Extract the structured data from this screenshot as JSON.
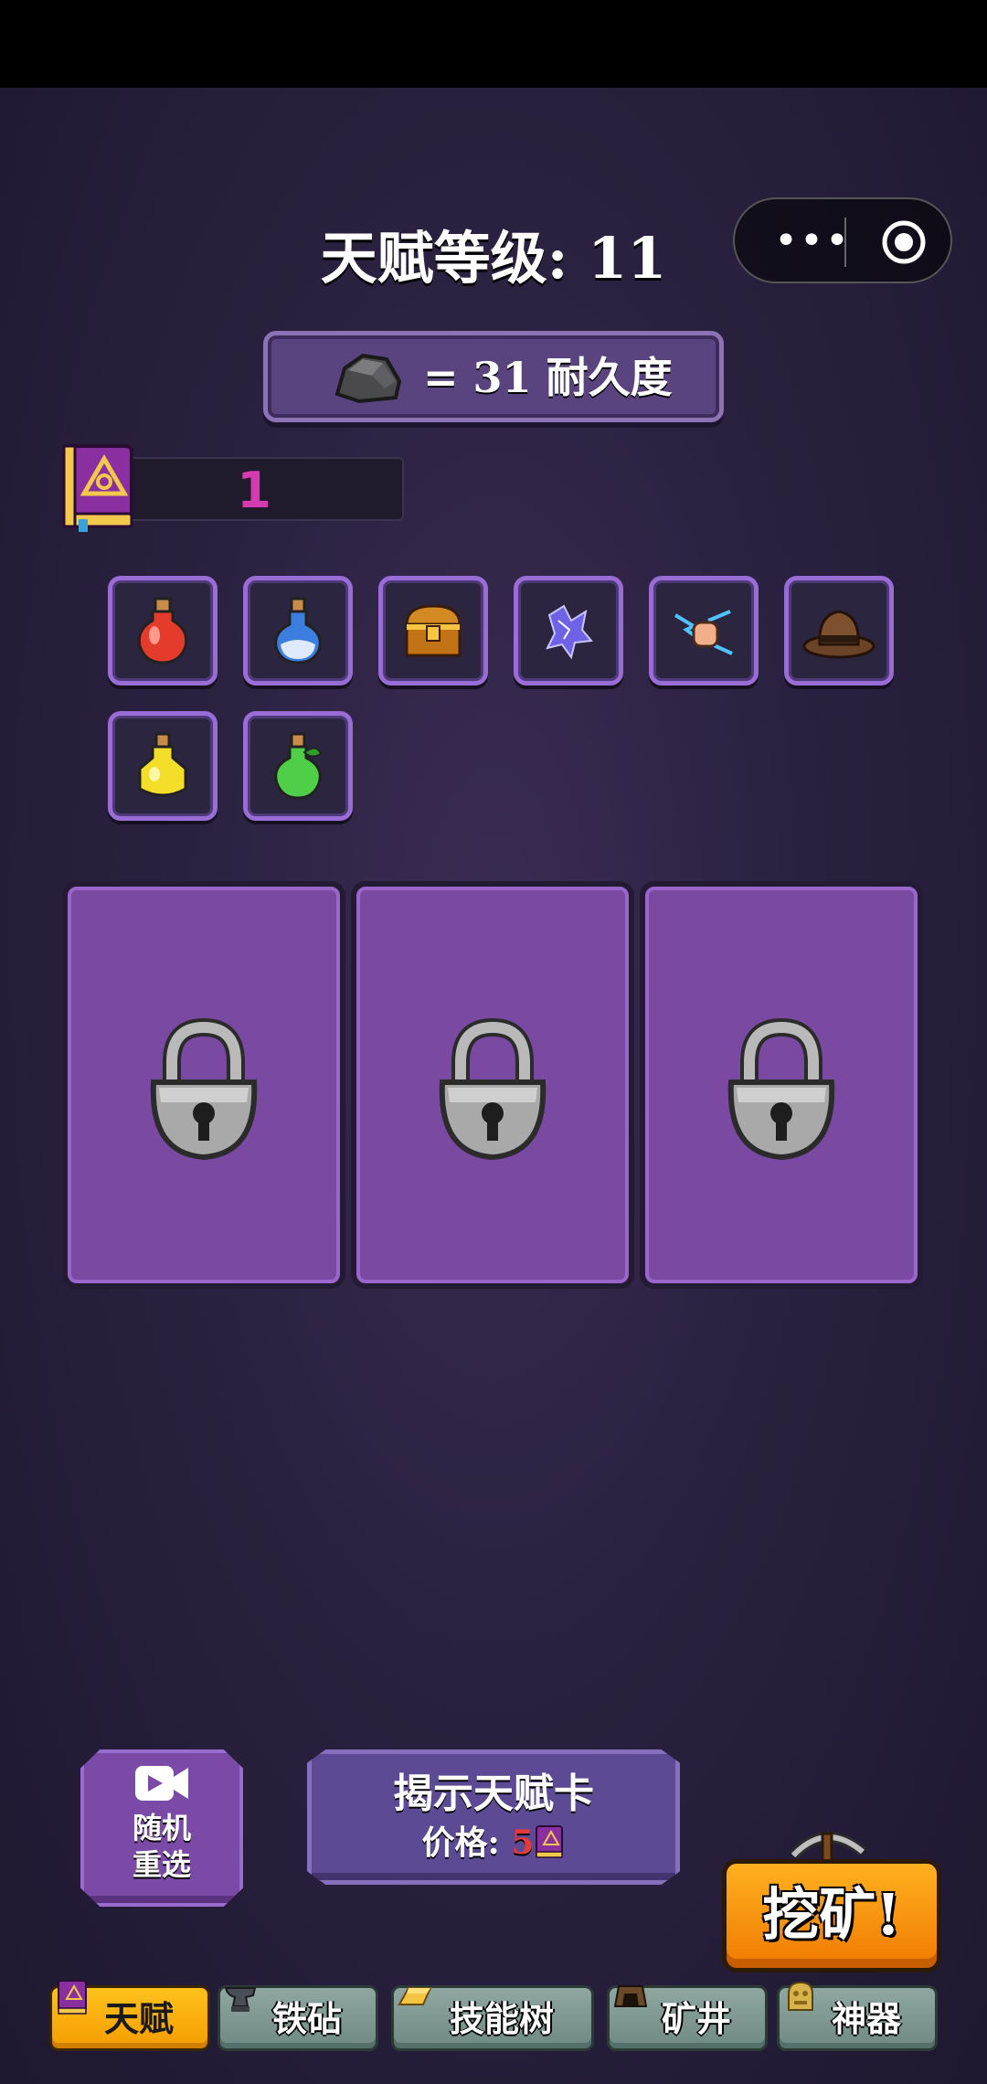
{
  "header": {
    "title": "天赋等级: 11",
    "menu_icon": "more-dots-icon",
    "close_icon": "target-icon"
  },
  "durability": {
    "icon": "rock-icon",
    "text": "= 31 耐久度"
  },
  "talent_books": {
    "icon": "talent-book-icon",
    "count": "1",
    "count_color": "#d53bb0"
  },
  "items": [
    {
      "name": "red-potion-icon"
    },
    {
      "name": "blue-potion-icon"
    },
    {
      "name": "treasure-chest-icon"
    },
    {
      "name": "lightning-crystal-icon"
    },
    {
      "name": "lightning-fist-icon"
    },
    {
      "name": "fedora-hat-icon"
    },
    {
      "name": "yellow-potion-icon"
    },
    {
      "name": "green-potion-icon"
    }
  ],
  "cards": [
    {
      "state": "locked",
      "icon": "padlock-icon"
    },
    {
      "state": "locked",
      "icon": "padlock-icon"
    },
    {
      "state": "locked",
      "icon": "padlock-icon"
    }
  ],
  "actions": {
    "reroll_line1": "随机",
    "reroll_line2": "重选",
    "reveal_title": "揭示天赋卡",
    "reveal_price_label": "价格: ",
    "reveal_price_value": "5",
    "mine_label": "挖矿!"
  },
  "bottom_nav": [
    {
      "label": "天赋",
      "icon": "talent-book-icon",
      "active": true
    },
    {
      "label": "铁砧",
      "icon": "anvil-icon",
      "active": false
    },
    {
      "label": "技能树",
      "icon": "gold-bar-icon",
      "active": false
    },
    {
      "label": "矿井",
      "icon": "mine-cart-icon",
      "active": false
    },
    {
      "label": "神器",
      "icon": "artifact-icon",
      "active": false
    }
  ],
  "colors": {
    "accent_orange": "#f49c00",
    "card_purple": "#7a4aa3",
    "slot_border": "#9a6cd6"
  }
}
